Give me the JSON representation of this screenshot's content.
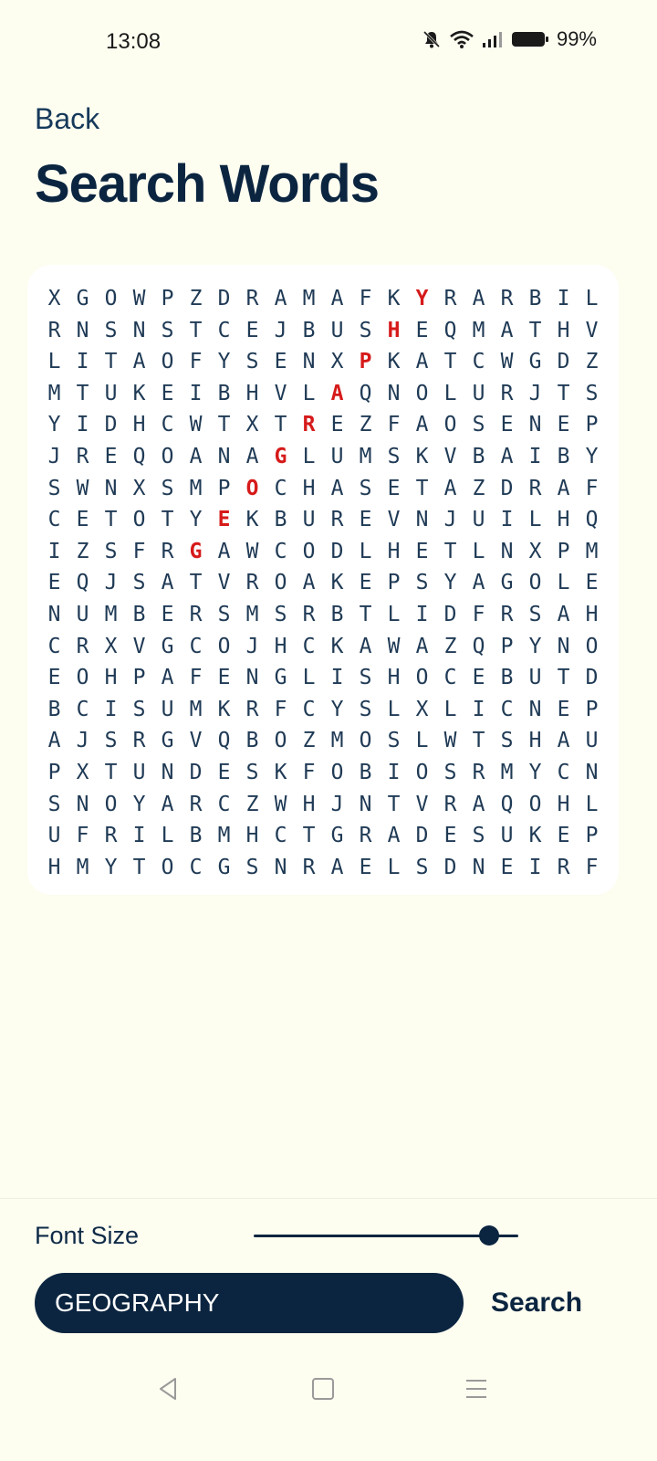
{
  "status_bar": {
    "time": "13:08",
    "battery_percent": "99%",
    "icons": [
      "mute-icon",
      "wifi-icon",
      "signal-icon",
      "battery-icon"
    ]
  },
  "header": {
    "back_label": "Back",
    "title": "Search Words"
  },
  "puzzle": {
    "rows": [
      "XGOWPZDRAMAFKYRARBIL",
      "RNSNSTCEJBUSHEQMATHV",
      "LITAOFYSENXPKATCWGDZ",
      "MTUKEIBHVLAQNOLURJTS",
      "YIDHCWTXTREZFAOSENEP",
      "JREQOANAGLUMSKVBAIBY",
      "SWNXSMPOCHASETAZDRAF",
      "CETOTYEKBUREVNJUILHQ",
      "IZSFRGAWCODLHETLNXPM",
      "EQJSATVROAKEPSYAGOLE",
      "NUMBERSMSRBTLIDFRSAH",
      "CRXVGCOJHCKAWAZQPYNO",
      "EOHPAFENGLISHOCEBUTD",
      "BCISUMKRFCYSLXLICNEP",
      "AJSRGVQBOZMOSLWTSHAU",
      "PXTUNDESKFOBIOSRMYCN",
      "SNOYARCZWHJNTVRAQOHL",
      "UFRILBMHCTGRADESUKEP",
      "HMYTOCGSNRAELSDNEIRF"
    ],
    "highlighted": [
      [
        0,
        13
      ],
      [
        1,
        12
      ],
      [
        2,
        11
      ],
      [
        3,
        10
      ],
      [
        4,
        9
      ],
      [
        5,
        8
      ],
      [
        6,
        7
      ],
      [
        7,
        6
      ],
      [
        8,
        5
      ]
    ],
    "highlight_color": "#d61a1a",
    "letter_color": "#1f3a55"
  },
  "controls": {
    "font_size_label": "Font Size",
    "font_size_level": 0.92,
    "search_value": "GEOGRAPHY",
    "search_button_label": "Search"
  },
  "nav": {
    "icons": [
      "back-triangle-icon",
      "home-square-icon",
      "menu-lines-icon"
    ]
  },
  "colors": {
    "background": "#fdfdf0",
    "accent": "#0b2540"
  }
}
